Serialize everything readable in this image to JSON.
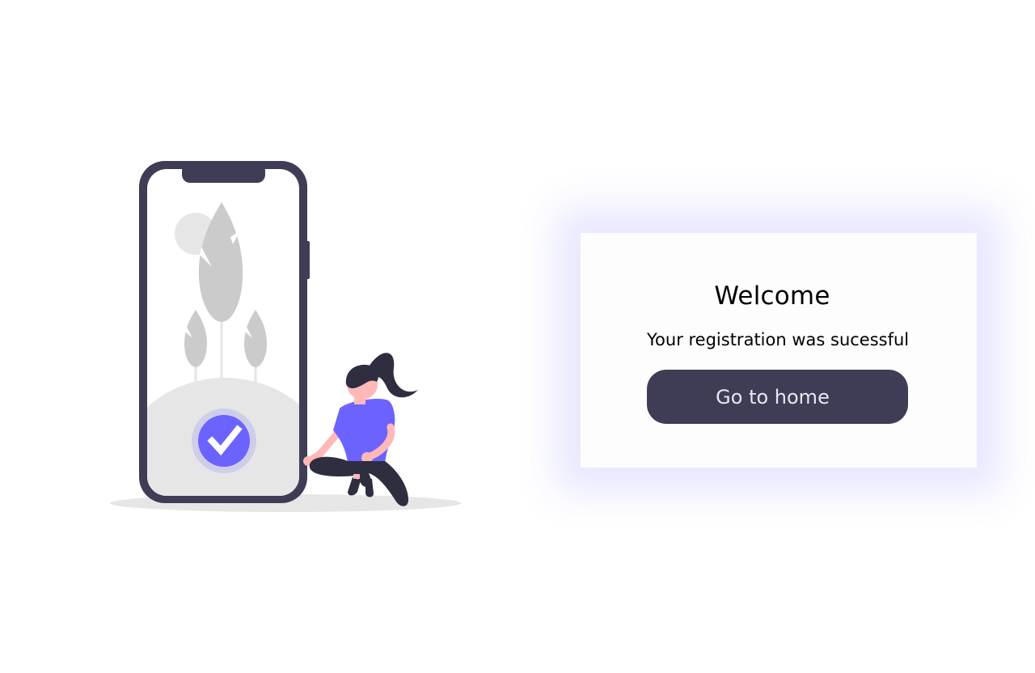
{
  "card": {
    "title": "Welcome",
    "message": "Your registration was sucessful",
    "button_label": "Go to home"
  },
  "illustration": {
    "description_icons": [
      "phone-icon",
      "check-circle-icon",
      "leaf-icon",
      "woman-figure"
    ]
  },
  "colors": {
    "accent": "#6c63ff",
    "button_bg": "#3f3d56",
    "button_text": "#e8e6f0",
    "phone_frame": "#3f3d56",
    "leaf_gray": "#cbcbcb",
    "ground_gray": "#e6e6e6",
    "skin": "#ffb8b8"
  }
}
